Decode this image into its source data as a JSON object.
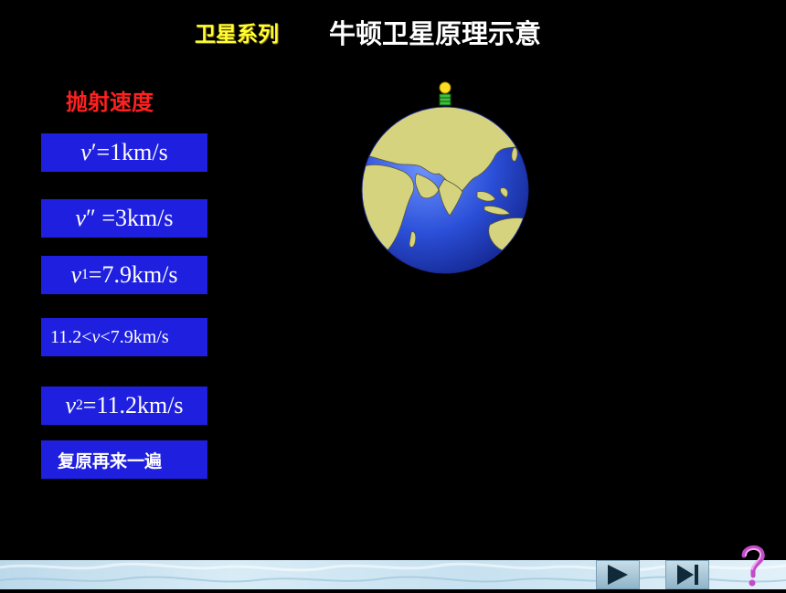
{
  "header": {
    "series": "卫星系列",
    "title": "牛顿卫星原理示意"
  },
  "speeds": {
    "label": "抛射速度",
    "b1": {
      "v": "v",
      "text": "′=1km/s"
    },
    "b2": {
      "v": "v",
      "text": "″ =3km/s"
    },
    "b3": {
      "v": "v",
      "sub": "1",
      "text": "=7.9km/s"
    },
    "b4": {
      "pre": "11.2<",
      "v": "v",
      "post": " <7.9km/s"
    },
    "b5": {
      "v": "v",
      "sub": "2",
      "text": "=11.2km/s"
    },
    "reset": "复原再来一遍"
  },
  "colors": {
    "background": "#000000",
    "button": "#1f1fe0",
    "series_title": "#ffff33",
    "section_label": "#ff2020",
    "ocean": "#2b4fd8",
    "land": "#d6d37e"
  },
  "icons": {
    "nav_play": "play-icon",
    "nav_end": "skip-end-icon",
    "help": "question-mark-icon",
    "cannon": "cannon-icon"
  }
}
